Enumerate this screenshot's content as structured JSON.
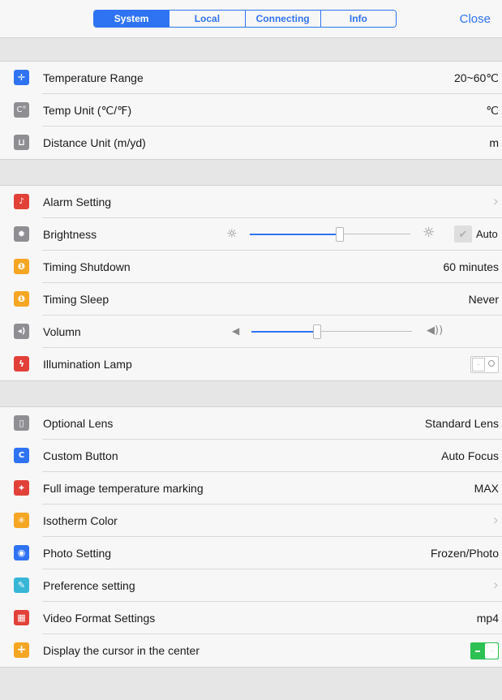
{
  "tabs": [
    "System",
    "Local",
    "Connecting",
    "Info"
  ],
  "active_tab": "System",
  "close_label": "Close",
  "group1": [
    {
      "label": "Temperature Range",
      "value": "20~60℃",
      "icon": "crosshair-icon",
      "color": "#2f73f2",
      "glyph": "✛"
    },
    {
      "label": "Temp Unit (℃/℉)",
      "value": "℃",
      "icon": "celsius-icon",
      "color": "#8e8e93",
      "glyph": "C°"
    },
    {
      "label": "Distance Unit (m/yd)",
      "value": "m",
      "icon": "ruler-icon",
      "color": "#8e8e93",
      "glyph": "⊔"
    }
  ],
  "group2": {
    "alarm": {
      "label": "Alarm Setting",
      "icon": "alarm-icon",
      "color": "#e24139",
      "glyph": "🔔"
    },
    "brightness": {
      "label": "Brightness",
      "icon": "brightness-icon",
      "color": "#8e8e93",
      "level": 0.55,
      "auto_label": "Auto"
    },
    "timing_shutdown": {
      "label": "Timing Shutdown",
      "value": "60 minutes",
      "icon": "timer-icon",
      "color": "#f5a623"
    },
    "timing_sleep": {
      "label": "Timing Sleep",
      "value": "Never",
      "icon": "sleep-icon",
      "color": "#f5a623"
    },
    "volume": {
      "label": "Volumn",
      "icon": "volume-icon",
      "color": "#8e8e93",
      "level": 0.4
    },
    "lamp": {
      "label": "Illumination Lamp",
      "icon": "lamp-icon",
      "color": "#e24139",
      "on": false
    }
  },
  "group3": [
    {
      "label": "Optional Lens",
      "value": "Standard Lens",
      "icon": "lens-icon",
      "color": "#8e8e93",
      "glyph": "▯"
    },
    {
      "label": "Custom Button",
      "value": "Auto Focus",
      "icon": "custom-button-icon",
      "color": "#2f73f2",
      "glyph": "C"
    },
    {
      "label": "Full image temperature marking",
      "value": "MAX",
      "icon": "marking-icon",
      "color": "#e24139",
      "glyph": "⌖"
    },
    {
      "label": "Isotherm Color",
      "value": "",
      "chevron": true,
      "icon": "isotherm-icon",
      "color": "#f5a623",
      "glyph": "✳"
    },
    {
      "label": "Photo Setting",
      "value": "Frozen/Photo",
      "icon": "camera-icon",
      "color": "#2f73f2",
      "glyph": "◉"
    },
    {
      "label": "Preference setting",
      "value": "",
      "chevron": true,
      "icon": "wrench-icon",
      "color": "#37b6d6",
      "glyph": "✎"
    },
    {
      "label": "Video Format Settings",
      "value": "mp4",
      "icon": "video-icon",
      "color": "#e24139",
      "glyph": "▦"
    },
    {
      "label": "Display the cursor in the center",
      "toggle": true,
      "on": true,
      "icon": "cursor-icon",
      "color": "#f5a623",
      "glyph": "+"
    }
  ]
}
